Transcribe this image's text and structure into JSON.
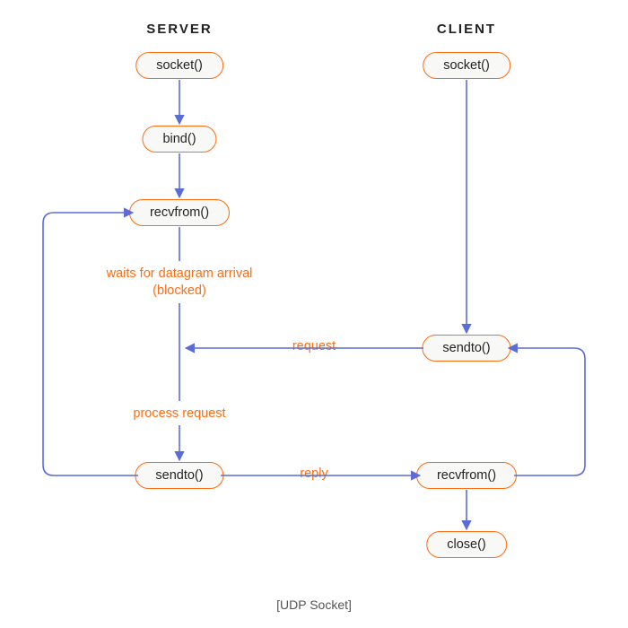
{
  "title": "UDP Socket flow diagram",
  "headers": {
    "server": "SERVER",
    "client": "CLIENT"
  },
  "nodes": {
    "server_socket": "socket()",
    "server_bind": "bind()",
    "server_recvfrom": "recvfrom()",
    "server_sendto": "sendto()",
    "client_socket": "socket()",
    "client_sendto": "sendto()",
    "client_recvfrom": "recvfrom()",
    "client_close": "close()"
  },
  "annotations": {
    "waits_line1": "waits for datagram arrival",
    "waits_line2": "(blocked)",
    "process": "process request",
    "request": "request",
    "reply": "reply"
  },
  "caption": "[UDP Socket]",
  "colors": {
    "node_border": "#ff6c12",
    "node_fill": "#f8f8f7",
    "arrow": "#5a6cd6",
    "annotation": "#ff6c12"
  },
  "diagram_data": {
    "type": "flowchart",
    "lanes": [
      "SERVER",
      "CLIENT"
    ],
    "steps": {
      "SERVER": [
        "socket()",
        "bind()",
        "recvfrom()",
        "sendto()"
      ],
      "CLIENT": [
        "socket()",
        "sendto()",
        "recvfrom()",
        "close()"
      ]
    },
    "edges": [
      {
        "from": "SERVER.socket()",
        "to": "SERVER.bind()"
      },
      {
        "from": "SERVER.bind()",
        "to": "SERVER.recvfrom()"
      },
      {
        "from": "SERVER.recvfrom()",
        "to": "SERVER.sendto()",
        "label": "waits for datagram arrival (blocked) / process request"
      },
      {
        "from": "SERVER.sendto()",
        "to": "SERVER.recvfrom()",
        "label": "loop back"
      },
      {
        "from": "CLIENT.socket()",
        "to": "CLIENT.sendto()"
      },
      {
        "from": "CLIENT.sendto()",
        "to": "SERVER.recvfrom()",
        "label": "request"
      },
      {
        "from": "SERVER.sendto()",
        "to": "CLIENT.recvfrom()",
        "label": "reply"
      },
      {
        "from": "CLIENT.recvfrom()",
        "to": "CLIENT.sendto()",
        "label": "loop back"
      },
      {
        "from": "CLIENT.recvfrom()",
        "to": "CLIENT.close()"
      }
    ]
  }
}
